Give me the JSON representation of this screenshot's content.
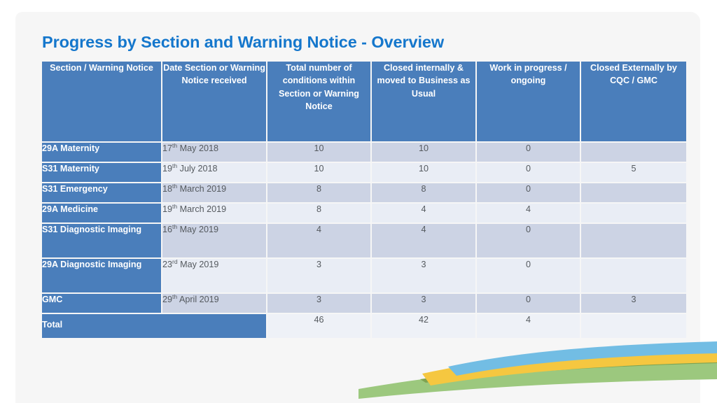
{
  "slide": {
    "title": "Progress by Section and Warning Notice - Overview",
    "title_color": "#1577cc",
    "background_color": "#f6f6f6",
    "header_fill": "#4a7ebb",
    "band_dark": "#ccd3e4",
    "band_light": "#e9edf5"
  },
  "table": {
    "headers": [
      "Section / Warning Notice",
      "Date Section or Warning Notice received",
      "Total number of conditions within Section or Warning Notice",
      "Closed internally & moved to Business as Usual",
      "Work in progress / ongoing",
      "Closed Externally by CQC / GMC"
    ],
    "rows": [
      {
        "section": "29A Maternity",
        "date_day": "17",
        "date_ord": "th",
        "date_rest": " May 2018",
        "total": "10",
        "closed_internally": "10",
        "work_in_progress": "0",
        "closed_externally": ""
      },
      {
        "section": "S31 Maternity",
        "date_day": "19",
        "date_ord": "th",
        "date_rest": " July 2018",
        "total": "10",
        "closed_internally": "10",
        "work_in_progress": "0",
        "closed_externally": "5"
      },
      {
        "section": "S31 Emergency",
        "date_day": "18",
        "date_ord": "th",
        "date_rest": " March 2019",
        "total": "8",
        "closed_internally": "8",
        "work_in_progress": "0",
        "closed_externally": ""
      },
      {
        "section": "29A Medicine",
        "date_day": "19",
        "date_ord": "th",
        "date_rest": " March 2019",
        "total": "8",
        "closed_internally": "4",
        "work_in_progress": "4",
        "closed_externally": ""
      },
      {
        "section": "S31 Diagnostic Imaging",
        "date_day": "16",
        "date_ord": "th",
        "date_rest": " May 2019",
        "total": "4",
        "closed_internally": "4",
        "work_in_progress": "0",
        "closed_externally": ""
      },
      {
        "section": "29A Diagnostic Imaging",
        "date_day": "23",
        "date_ord": "rd",
        "date_rest": " May 2019",
        "total": "3",
        "closed_internally": "3",
        "work_in_progress": "0",
        "closed_externally": ""
      },
      {
        "section": "GMC",
        "date_day": "29",
        "date_ord": "th",
        "date_rest": " April 2019",
        "total": "3",
        "closed_internally": "3",
        "work_in_progress": "0",
        "closed_externally": "3"
      }
    ],
    "total_row": {
      "label": "Total",
      "total": "46",
      "closed_internally": "42",
      "work_in_progress": "4",
      "closed_externally": ""
    }
  },
  "decoration": {
    "wave_blue": "#72bde4",
    "wave_yellow": "#f5c740",
    "wave_green": "#9cc87e",
    "wave_olive": "#7fa352"
  }
}
